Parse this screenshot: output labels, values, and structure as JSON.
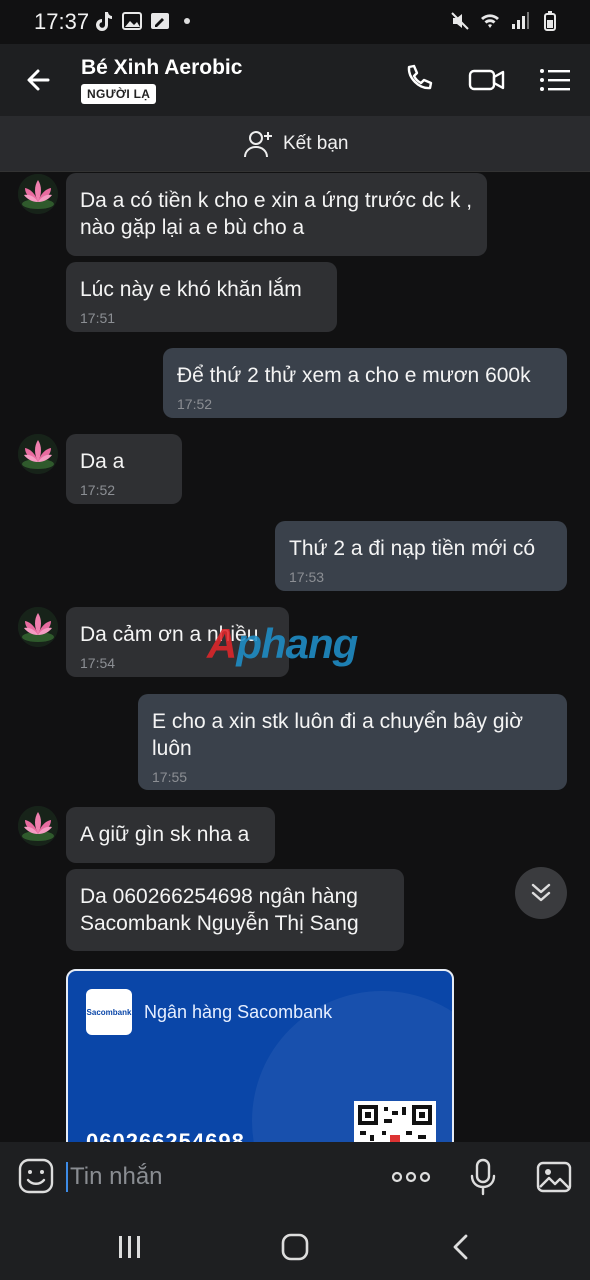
{
  "status_bar": {
    "time": "17:37"
  },
  "header": {
    "contact_name": "Bé Xinh Aerobic",
    "badge": "NGƯỜI LẠ"
  },
  "friend_bar": {
    "label": "Kết bạn"
  },
  "messages": [
    {
      "dir": "in",
      "text": "Da a có tiền k cho e xin a ứng trước dc k , nào gặp lại a e bù cho a",
      "time": ""
    },
    {
      "dir": "in",
      "text": "Lúc này e khó khăn lắm",
      "time": "17:51"
    },
    {
      "dir": "out",
      "text": "Để thứ 2 thử xem a cho e mươn 600k",
      "time": "17:52"
    },
    {
      "dir": "in",
      "text": "Da a",
      "time": "17:52"
    },
    {
      "dir": "out",
      "text": "Thứ 2 a đi nạp tiền mới có",
      "time": "17:53"
    },
    {
      "dir": "in",
      "text": "Da cảm ơn a nhiều",
      "time": "17:54"
    },
    {
      "dir": "out",
      "text": "E cho a xin stk luôn đi a chuyển bây giờ luôn",
      "time": "17:55"
    },
    {
      "dir": "in",
      "text": "A giữ gìn sk nha a",
      "time": ""
    },
    {
      "dir": "in",
      "text": "Da 060266254698 ngân hàng Sacombank Nguyễn Thị Sang",
      "time": ""
    }
  ],
  "bank_card": {
    "logo_text": "Sacombank",
    "bank_name": "Ngân hàng Sacombank",
    "account_number": "060266254698"
  },
  "watermark": {
    "part1": "A",
    "part2": "phang"
  },
  "input": {
    "placeholder": "Tin nhắn"
  },
  "colors": {
    "background": "#111112",
    "incoming_bubble": "#2f3033",
    "outgoing_bubble": "#3a414b",
    "bank_blue": "#0a46a8"
  }
}
